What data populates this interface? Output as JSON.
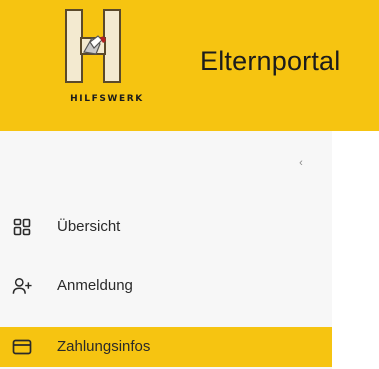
{
  "header": {
    "logo_text": "HILFSWERK",
    "app_title": "Elternportal"
  },
  "sidebar": {
    "collapse_icon": "chevron-left-icon",
    "items": [
      {
        "label": "Übersicht",
        "icon": "grid-icon",
        "active": false
      },
      {
        "label": "Anmeldung",
        "icon": "user-add-icon",
        "active": false
      },
      {
        "label": "Zahlungsinfos",
        "icon": "credit-card-icon",
        "active": true
      }
    ]
  },
  "colors": {
    "brand_yellow": "#f6c411",
    "sidebar_bg": "#f7f7f7",
    "text": "#2a2a2a"
  }
}
